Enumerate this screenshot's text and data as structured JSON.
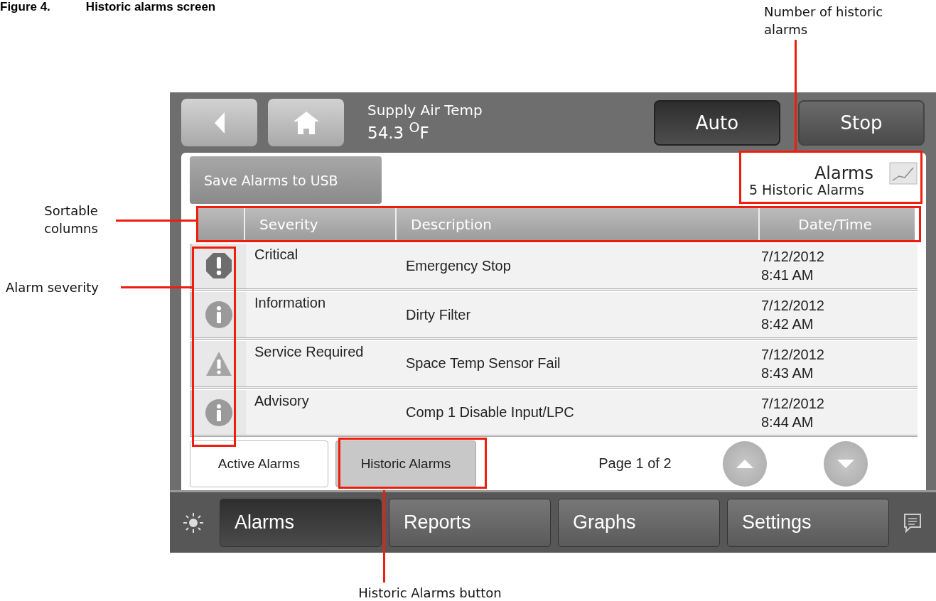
{
  "figure_caption": {
    "number": "Figure 4.",
    "title": "Historic alarms screen"
  },
  "header": {
    "point_name": "Supply Air Temp",
    "point_value": "54.3 $^{O}$F"
  },
  "mode_buttons": [
    {
      "label": "Auto",
      "selected": true
    },
    {
      "label": "Stop",
      "selected": false
    }
  ],
  "save_button": "Save Alarms to USB",
  "panel_title": "Alarms",
  "alarm_count": "5 Historic Alarms",
  "columns": [
    "Severity",
    "Description",
    "Date/Time"
  ],
  "rows": [
    {
      "kind": "critical",
      "severity": "Critical",
      "description": "Emergency Stop",
      "date": "7/12/2012",
      "time": "8:41 AM"
    },
    {
      "kind": "info",
      "severity": "Information",
      "description": "Dirty Filter",
      "date": "7/12/2012",
      "time": "8:42 AM"
    },
    {
      "kind": "warning",
      "severity": "Service Required",
      "description": "Space Temp Sensor Fail",
      "date": "7/12/2012",
      "time": "8:43 AM"
    },
    {
      "kind": "info",
      "severity": "Advisory",
      "description": "Comp 1 Disable Input/LPC",
      "date": "7/12/2012",
      "time": "8:44 AM"
    }
  ],
  "view_buttons": [
    {
      "label": "Active Alarms",
      "selected": false
    },
    {
      "label": "Historic Alarms",
      "selected": true
    }
  ],
  "pager": "Page 1 of 2",
  "nav_tabs": [
    {
      "label": "Alarms",
      "selected": true
    },
    {
      "label": "Reports",
      "selected": false
    },
    {
      "label": "Graphs",
      "selected": false
    },
    {
      "label": "Settings",
      "selected": false
    }
  ],
  "callouts": [
    "Number of historic alarms",
    "Sortable columns",
    "Alarm severity",
    "Historic Alarms button"
  ]
}
